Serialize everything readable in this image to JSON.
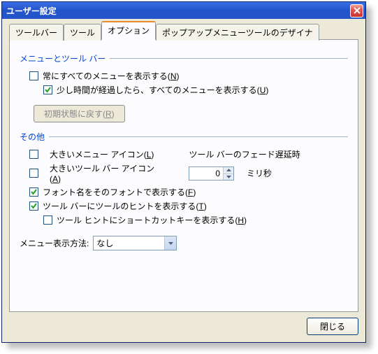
{
  "window": {
    "title": "ユーザー設定"
  },
  "tabs": {
    "toolbar": "ツールバー",
    "tool": "ツール",
    "options": "オプション",
    "popup_designer": "ポップアップメニューツールのデザイナ"
  },
  "group1": {
    "title": "メニューとツール バー",
    "always_show_full": {
      "label": "常にすべてのメニューを表示する(",
      "accel": "N",
      "suffix": ")",
      "checked": false
    },
    "show_full_after_delay": {
      "label": "少し時間が経過したら、すべてのメニューを表示する(",
      "accel": "U",
      "suffix": ")",
      "checked": true
    },
    "reset": {
      "label": "初期状態に戻す(",
      "accel": "R",
      "suffix": ")"
    }
  },
  "group2": {
    "title": "その他",
    "large_menu_icons": {
      "label": "大きいメニュー アイコン(",
      "accel": "L",
      "suffix": ")",
      "checked": false
    },
    "fade_label": "ツール バーのフェード遅延時",
    "large_toolbar_icons": {
      "label": "大きいツール バー アイコン(",
      "accel": "A",
      "suffix": ")",
      "checked": false
    },
    "spin_value": "0",
    "ms_label": "ミリ秒",
    "font_in_font": {
      "label": "フォント名をそのフォントで表示する(",
      "accel": "F",
      "suffix": ")",
      "checked": true
    },
    "show_tool_hints": {
      "label": "ツール バーにツールのヒントを表示する(",
      "accel": "T",
      "suffix": ")",
      "checked": true
    },
    "show_shortcut_in_hints": {
      "label": "ツール ヒントにショートカットキーを表示する(",
      "accel": "H",
      "suffix": ")",
      "checked": false
    }
  },
  "menu_anim": {
    "label": "メニュー表示方法:",
    "value": "なし"
  },
  "buttons": {
    "close": "閉じる"
  }
}
